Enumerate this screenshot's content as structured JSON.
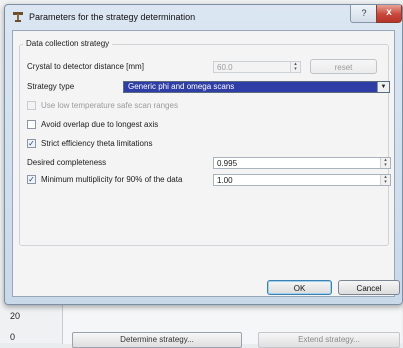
{
  "dialog": {
    "title": "Parameters for the strategy determination",
    "help_label": "?",
    "close_label": "x",
    "group_title": "Data collection strategy",
    "crystal_label": "Crystal to detector distance [mm]",
    "crystal_value": "60.0",
    "reset_label": "reset",
    "strategy_label": "Strategy type",
    "strategy_value": "Generic phi and omega scans",
    "options": [
      {
        "label": "Use low temperature safe scan ranges",
        "checked": false,
        "enabled": false
      },
      {
        "label": "Avoid overlap due to longest axis",
        "checked": false,
        "enabled": true
      },
      {
        "label": "Strict efficiency theta limitations",
        "checked": true,
        "enabled": true
      }
    ],
    "completeness_label": "Desired completeness",
    "completeness_value": "0.995",
    "multiplicity_label": "Minimum multiplicity for 90% of the data",
    "multiplicity_checked": true,
    "multiplicity_value": "1.00",
    "ok_label": "OK",
    "cancel_label": "Cancel"
  },
  "background": {
    "row_numbers": [
      "20",
      "0"
    ],
    "determine_label": "Determine strategy...",
    "extend_label": "Extend strategy..."
  }
}
